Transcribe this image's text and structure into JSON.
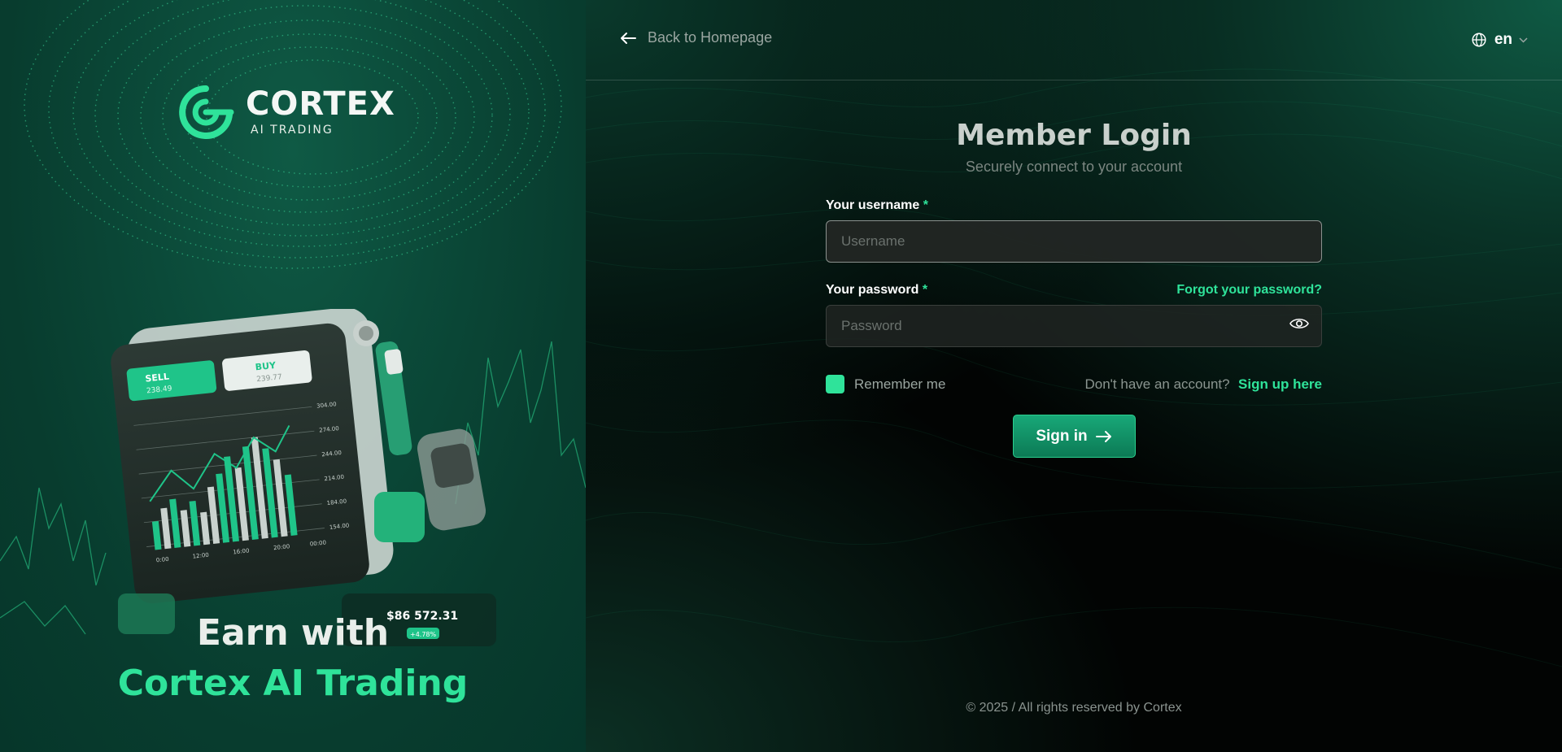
{
  "brand": {
    "name": "CORTEX",
    "tagline": "AI TRADING",
    "accent": "#2fe39a"
  },
  "hero": {
    "line1": "Earn with",
    "line2": "Cortex AI Trading"
  },
  "illustration": {
    "sell_label": "SELL",
    "sell_value": "238.49",
    "buy_label": "BUY",
    "buy_value": "239.77",
    "y_ticks": [
      "304.00",
      "274.00",
      "244.00",
      "214.00",
      "184.00",
      "154.00"
    ],
    "x_ticks": [
      "0:00",
      "12:00",
      "16:00",
      "20:00",
      "00:00"
    ],
    "balance": "$86 572.31",
    "balance_change": "+4.78%"
  },
  "nav": {
    "back_label": "Back to Homepage",
    "language": "en"
  },
  "login": {
    "title": "Member Login",
    "subtitle": "Securely connect to your account",
    "username_label": "Your username",
    "username_placeholder": "Username",
    "password_label": "Your password",
    "password_placeholder": "Password",
    "required_mark": "*",
    "forgot_label": "Forgot your password?",
    "remember_label": "Remember me",
    "remember_checked": true,
    "no_account_text": "Don't have an account?",
    "signup_label": "Sign up here",
    "signin_label": "Sign in"
  },
  "footer": {
    "copyright": "© 2025 / All rights reserved by Cortex"
  }
}
